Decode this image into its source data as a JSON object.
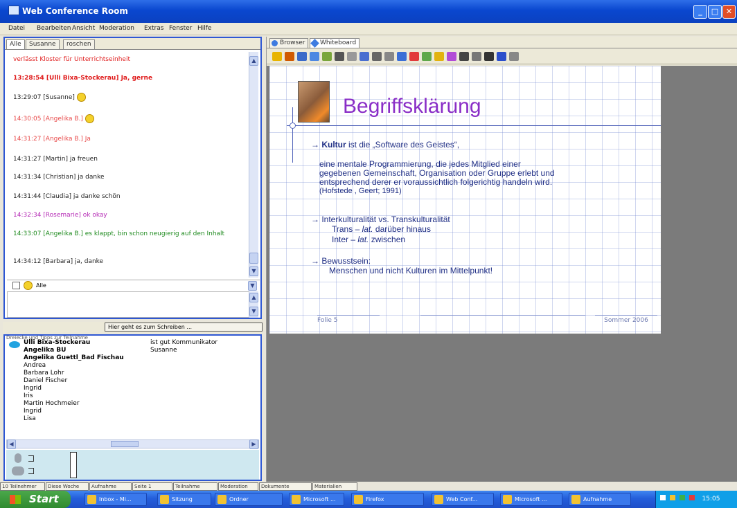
{
  "window": {
    "title": "Web Conference Room"
  },
  "menu": [
    "Datei",
    "Bearbeiten",
    "Ansicht",
    "Moderation",
    "Extras",
    "Fenster",
    "Hilfe"
  ],
  "chat": {
    "tabs": [
      "Alle",
      "Susanne",
      "roschen"
    ],
    "messages": [
      {
        "text": "verlässt Kloster für Unterrichtseinheit",
        "color": "#e01e1e",
        "bold": false
      },
      {
        "text": "13:28:54 [Ulli Bixa-Stockerau] Ja, gerne",
        "color": "#e01e1e",
        "bold": true
      },
      {
        "text": "13:29:07 [Susanne]",
        "color": "#222222",
        "bold": false,
        "smiley": true
      },
      {
        "text": "14:30:05 [Angelika B.]",
        "color": "#e84a4a",
        "bold": false,
        "smiley": true
      },
      {
        "text": "14:31:27 [Angelika B.] Ja",
        "color": "#e84a4a",
        "bold": false
      },
      {
        "text": "14:31:27 [Martin] ja freuen",
        "color": "#222222",
        "bold": false
      },
      {
        "text": "14:31:34 [Christian] ja danke",
        "color": "#222222",
        "bold": false
      },
      {
        "text": "14:31:44 [Claudia] ja danke schön",
        "color": "#222222",
        "bold": false
      },
      {
        "text": "14:32:34 [Rosemarie] ok okay",
        "color": "#b52ab5",
        "bold": false
      },
      {
        "text": "14:33:07 [Angelika B.] es klappt, bin schon neugierig auf den Inhalt",
        "color": "#1e8a1e",
        "bold": false
      },
      {
        "text": "14:34:12 [Barbara] ja, danke",
        "color": "#222222",
        "bold": false
      }
    ],
    "input_target": "Alle"
  },
  "slider": {
    "label": "Hier geht es zum Schreiben ..."
  },
  "participants": {
    "header": "Dreiecke und Tipps zur Teilnahme",
    "names": [
      "Ulli Bixa-Stockerau",
      "Angelika BU",
      "Angelika Guettl_Bad Fischau",
      "Andrea",
      "Barbara Lohr",
      "Daniel Fischer",
      "Ingrid",
      "Iris",
      "Martin Hochmeier",
      "Ingrid",
      "Lisa"
    ],
    "bold_count": 3,
    "status": [
      "ist gut Kommunikator",
      "Susanne"
    ]
  },
  "bottom_tabs": [
    "10 Teilnehmer",
    "Diese Woche",
    "Aufnahme",
    "Seite 1",
    "Teilnahme",
    "Moderation",
    "Dokumente",
    "Materialien"
  ],
  "right": {
    "tabs": [
      "Browser",
      "Whiteboard"
    ],
    "toolbar_colors": [
      "#e8b400",
      "#d05a00",
      "#3a6ac9",
      "#4d88e2",
      "#7aa63b",
      "#555555",
      "#999999",
      "#4a6fd0",
      "#666666",
      "#888888",
      "#3b6fd6",
      "#e23b3b",
      "#5fa84a",
      "#e2b20f",
      "#b24bd6",
      "#444444",
      "#777777",
      "#333333",
      "#2b4ecb",
      "#888888"
    ]
  },
  "slide": {
    "title": "Begriffsklärung",
    "lines": [
      "→ Kultur ist die „Software des Geistes“,",
      "eine mentale Programmierung, die jedes Mitglied einer",
      "gegebenen Gemeinschaft, Organisation oder Gruppe erlebt und",
      "entsprechend derer er voraussichtlich folgerichtig handeln wird.",
      "(Hofstede , Geert; 1991)",
      "→ Interkulturalität vs. Transkulturalität",
      "Trans – lat. darüber hinaus",
      "Inter – lat. zwischen",
      "→ Bewusstsein:",
      "Menschen und nicht Kulturen im Mittelpunkt!"
    ],
    "footer_left": "Folie 5",
    "footer_right": "Sommer 2006"
  },
  "taskbar": {
    "start": "Start",
    "tasks": [
      "Inbox - Mi...",
      "Sitzung",
      "Ordner",
      "Microsoft ...",
      "Firefox",
      "Web Conf...",
      "Microsoft ...",
      "Aufnahme"
    ],
    "clock": "15:05"
  }
}
